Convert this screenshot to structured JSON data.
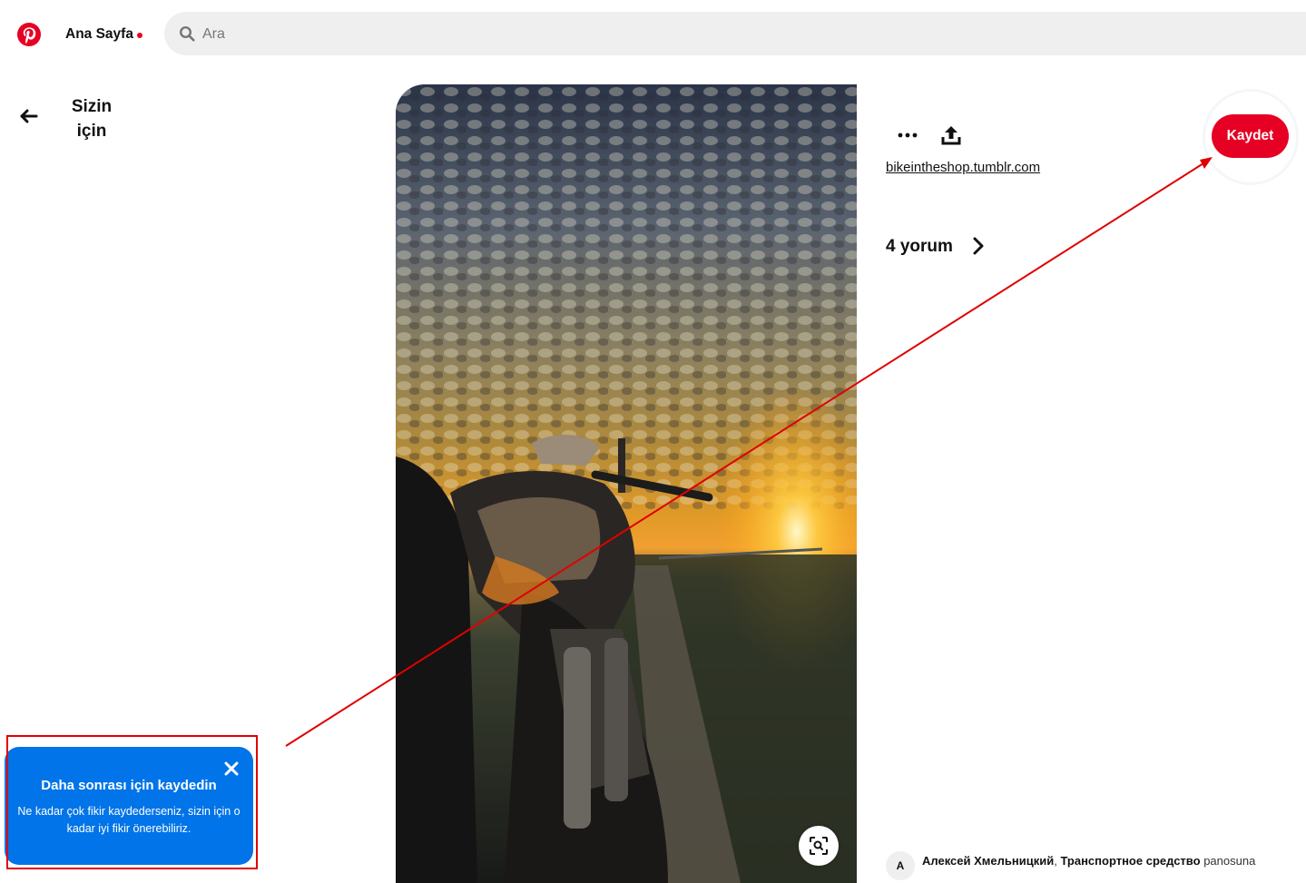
{
  "header": {
    "logo_icon": "pinterest-logo-icon",
    "home_label": "Ana Sayfa",
    "notification_dot_color": "#e60023",
    "search": {
      "placeholder": "Ara",
      "value": "",
      "icon": "search-icon"
    }
  },
  "nav": {
    "back_icon": "arrow-left-icon",
    "back_label_line1": "Sizin",
    "back_label_line2": "için"
  },
  "pin": {
    "image_description_icon": "motorcycle-sunset-image",
    "more_icon": "ellipsis-icon",
    "share_icon": "share-icon",
    "source_link": "bikeintheshop.tumblr.com",
    "save_label": "Kaydet",
    "comments_label": "4 yorum",
    "visual_search_icon": "visual-search-icon",
    "activity": {
      "avatar_initial": "A",
      "user": "Алексей Хмельницкий",
      "separator": ",",
      "board": "Транспортное средство",
      "suffix": "panosuna"
    }
  },
  "tooltip": {
    "title": "Daha sonrası için kaydedin",
    "body": "Ne kadar çok fikir kaydederseniz, sizin için o kadar iyi fikir önerebiliriz.",
    "close_icon": "close-icon"
  },
  "colors": {
    "brand": "#e60023",
    "tooltip_bg": "#0074e8",
    "annotation": "#e00000"
  }
}
